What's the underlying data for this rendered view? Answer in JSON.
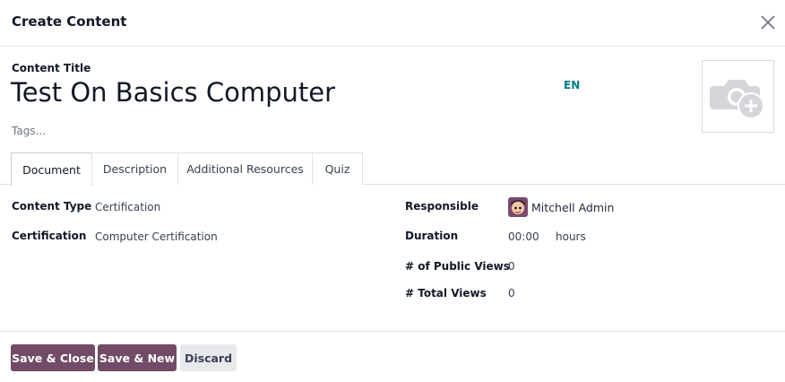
{
  "dialog": {
    "title": "Create Content",
    "close_icon": "close-icon"
  },
  "form": {
    "content_title_label": "Content Title",
    "content_title_value": "Test On Basics Computer",
    "language_badge": "EN",
    "tags_placeholder": "Tags...",
    "image_icon": "camera-add-icon"
  },
  "tabs": [
    {
      "label": "Document",
      "active": true
    },
    {
      "label": "Description",
      "active": false
    },
    {
      "label": "Additional Resources",
      "active": false
    },
    {
      "label": "Quiz",
      "active": false
    }
  ],
  "document": {
    "content_type_label": "Content Type",
    "content_type_value": "Certification",
    "certification_label": "Certification",
    "certification_value": "Computer Certification",
    "responsible_label": "Responsible",
    "responsible_value": "Mitchell Admin",
    "duration_label": "Duration",
    "duration_value": "00:00",
    "duration_unit": "hours",
    "public_views_label": "# of Public Views",
    "public_views_value": "0",
    "total_views_label": "# Total Views",
    "total_views_value": "0"
  },
  "footer": {
    "save_close": "Save & Close",
    "save_new": "Save & New",
    "discard": "Discard"
  },
  "colors": {
    "primary": "#714b67",
    "accent_teal": "#017e84",
    "secondary_button": "#e7e9ed"
  }
}
